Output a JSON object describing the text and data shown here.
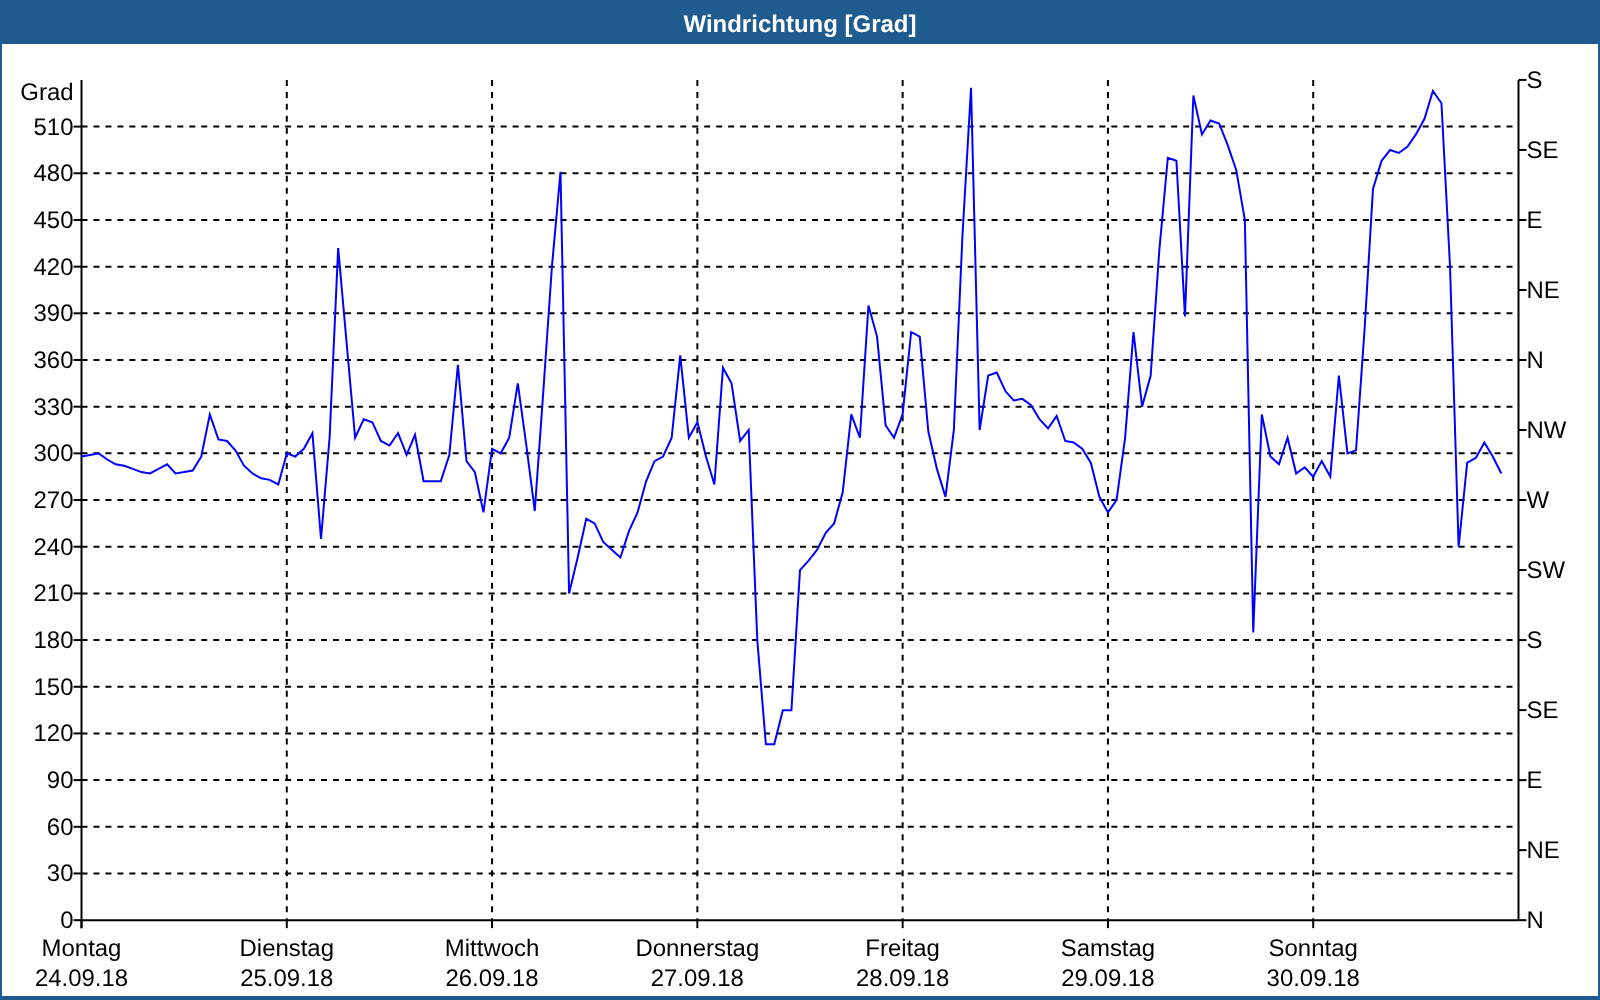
{
  "window": {
    "title": "Windrichtung [Grad]"
  },
  "chart": {
    "chart_data": {
      "type": "line",
      "ylabel": "Grad",
      "ylim": [
        0,
        540
      ],
      "grid": true,
      "yticks": [
        0,
        30,
        60,
        90,
        120,
        150,
        180,
        210,
        240,
        270,
        300,
        330,
        360,
        390,
        420,
        450,
        480,
        510
      ],
      "categories": [
        "Montag",
        null,
        null,
        null,
        null,
        null,
        null,
        null,
        null,
        null,
        null,
        null,
        null,
        null,
        null,
        null,
        null,
        null,
        null,
        null,
        null,
        null,
        null,
        null,
        "Dienstag",
        null,
        null,
        null,
        null,
        null,
        null,
        null,
        null,
        null,
        null,
        null,
        null,
        null,
        null,
        null,
        null,
        null,
        null,
        null,
        null,
        null,
        null,
        null,
        "Mittwoch",
        null,
        null,
        null,
        null,
        null,
        null,
        null,
        null,
        null,
        null,
        null,
        null,
        null,
        null,
        null,
        null,
        null,
        null,
        null,
        null,
        null,
        null,
        null,
        "Donnerstag",
        null,
        null,
        null,
        null,
        null,
        null,
        null,
        null,
        null,
        null,
        null,
        null,
        null,
        null,
        null,
        null,
        null,
        null,
        null,
        null,
        null,
        null,
        null,
        "Freitag",
        null,
        null,
        null,
        null,
        null,
        null,
        null,
        null,
        null,
        null,
        null,
        null,
        null,
        null,
        null,
        null,
        null,
        null,
        null,
        null,
        null,
        null,
        null,
        "Samstag",
        null,
        null,
        null,
        null,
        null,
        null,
        null,
        null,
        null,
        null,
        null,
        null,
        null,
        null,
        null,
        null,
        null,
        null,
        null,
        null,
        null,
        null,
        null,
        "Sonntag",
        null,
        null,
        null,
        null,
        null,
        null,
        null,
        null,
        null,
        null,
        null,
        null,
        null,
        null,
        null,
        null,
        null,
        null,
        null,
        null,
        null,
        null
      ],
      "series": [
        {
          "color": "#0000ff",
          "values": [
            298,
            299,
            300,
            296,
            293,
            292,
            290,
            288,
            287,
            290,
            293,
            287,
            288,
            289,
            298,
            325,
            309,
            308,
            302,
            292,
            287,
            284,
            283,
            280,
            300,
            298,
            303,
            313,
            245,
            310,
            432,
            370,
            310,
            322,
            320,
            308,
            305,
            313,
            299,
            312,
            282,
            282,
            282,
            299,
            357,
            295,
            288,
            262,
            303,
            300,
            310,
            345,
            305,
            263,
            340,
            420,
            481,
            210,
            233,
            258,
            255,
            243,
            238,
            233,
            250,
            262,
            282,
            295,
            298,
            310,
            363,
            310,
            320,
            298,
            280,
            355,
            345,
            308,
            315,
            180,
            113,
            113,
            135,
            135,
            225,
            231,
            238,
            249,
            255,
            275,
            325,
            310,
            395,
            375,
            318,
            310,
            325,
            378,
            375,
            314,
            290,
            272,
            315,
            440,
            535,
            315,
            350,
            352,
            340,
            334,
            335,
            331,
            322,
            316,
            324,
            308,
            307,
            303,
            294,
            272,
            262,
            270,
            310,
            378,
            330,
            350,
            430,
            490,
            488,
            388,
            530,
            505,
            514,
            512,
            498,
            482,
            450,
            185,
            325,
            298,
            293,
            310,
            287,
            291,
            285,
            295,
            285,
            350,
            300,
            302,
            380,
            470,
            488,
            495,
            493,
            497,
            505,
            515,
            533,
            525,
            420,
            240,
            294,
            297,
            307,
            298,
            287
          ]
        }
      ]
    },
    "x_dates": [
      "24.09.18",
      "25.09.18",
      "26.09.18",
      "27.09.18",
      "28.09.18",
      "29.09.18",
      "30.09.18"
    ],
    "compass_labels": [
      "S",
      "SE",
      "E",
      "NE",
      "N",
      "NW",
      "W",
      "SW",
      "S",
      "SE",
      "E",
      "NE",
      "N"
    ]
  }
}
